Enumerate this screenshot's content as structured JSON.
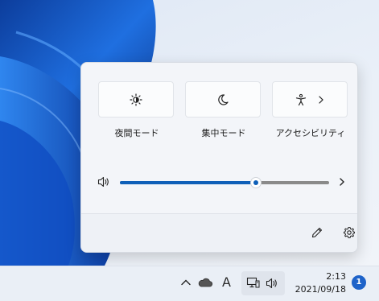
{
  "quick_settings": {
    "tiles": [
      {
        "label": "夜間モード",
        "icon": "brightness-sun-icon",
        "active": false
      },
      {
        "label": "集中モード",
        "icon": "moon-icon",
        "active": false
      },
      {
        "label": "アクセシビリティ",
        "icon": "accessibility-person-icon",
        "has_chevron": true,
        "active": false
      }
    ],
    "volume": {
      "icon": "speaker-icon",
      "level_fraction": 0.65
    },
    "footer": {
      "edit_icon": "pencil-icon",
      "settings_icon": "gear-icon"
    }
  },
  "taskbar": {
    "tray": {
      "overflow_icon": "chevron-up-icon",
      "onedrive_icon": "cloud-icon",
      "ime_indicator": "A",
      "network_icon": "network-monitor-icon",
      "volume_icon": "speaker-icon"
    },
    "clock": {
      "time": "2:13",
      "date": "2021/09/18"
    },
    "notification_count": "1"
  },
  "colors": {
    "accent": "#0e5fb8",
    "flyout_bg": "#f3f5f9",
    "taskbar_bg": "#eaeff6",
    "badge": "#1e63c9"
  }
}
